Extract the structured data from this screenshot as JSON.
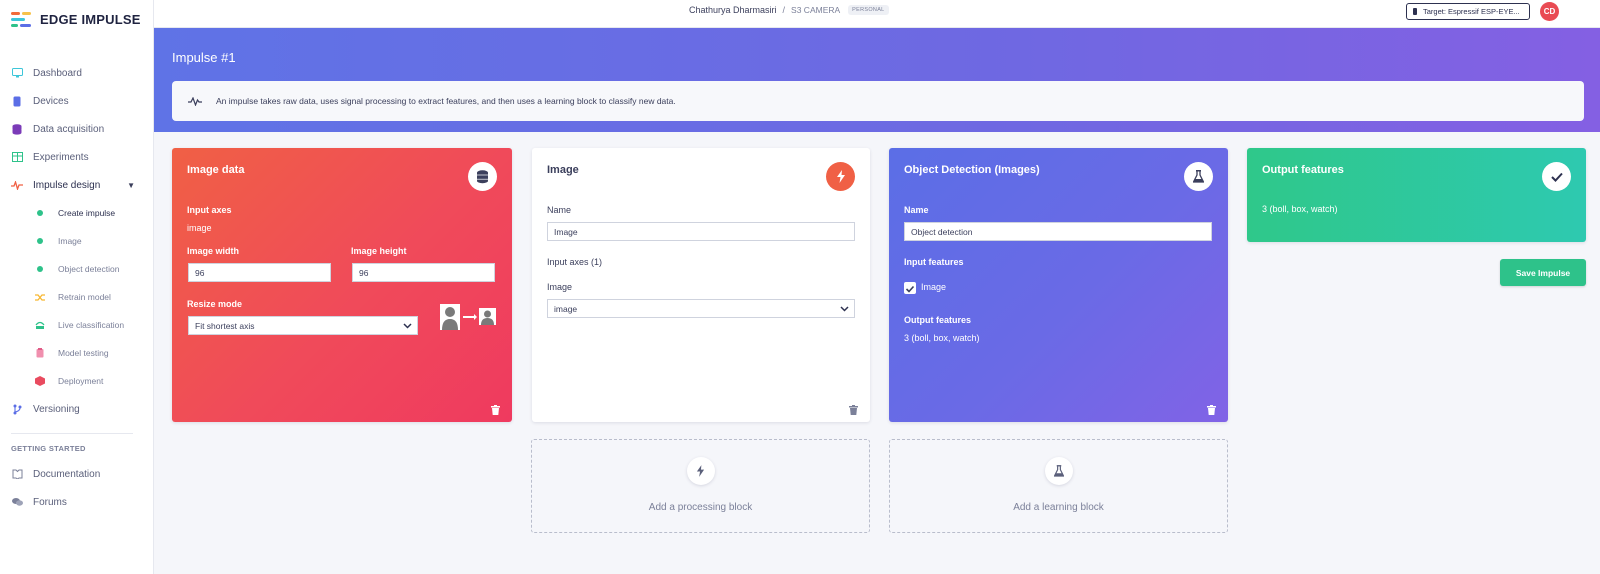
{
  "brand": {
    "name": "EDGE IMPULSE",
    "logo_colors": [
      "#f26b3a",
      "#f7c24a",
      "#3dc6d9",
      "#2ec28a"
    ]
  },
  "sidebar": {
    "items": [
      {
        "label": "Dashboard",
        "icon": "monitor-icon",
        "color": "#3dc6d9"
      },
      {
        "label": "Devices",
        "icon": "device-icon",
        "color": "#5b6ee6"
      },
      {
        "label": "Data acquisition",
        "icon": "database-icon",
        "color": "#7b3bb8"
      },
      {
        "label": "Experiments",
        "icon": "table-icon",
        "color": "#2ec28a"
      },
      {
        "label": "Impulse design",
        "icon": "pulse-icon",
        "color": "#f06045"
      }
    ],
    "sub_items": [
      {
        "label": "Create impulse",
        "icon": "dot-icon"
      },
      {
        "label": "Image",
        "icon": "dot-icon"
      },
      {
        "label": "Object detection",
        "icon": "dot-icon"
      },
      {
        "label": "Retrain model",
        "icon": "shuffle-icon"
      },
      {
        "label": "Live classification",
        "icon": "live-icon"
      },
      {
        "label": "Model testing",
        "icon": "clipboard-icon"
      },
      {
        "label": "Deployment",
        "icon": "box-icon"
      }
    ],
    "versioning": "Versioning",
    "getting_started": "GETTING STARTED",
    "documentation": "Documentation",
    "forums": "Forums"
  },
  "topbar": {
    "user": "Chathurya Dharmasiri",
    "separator": "/",
    "project": "S3 CAMERA",
    "badge": "PERSONAL",
    "target": "Target: Espressif ESP-EYE...",
    "avatar": "CD"
  },
  "header": {
    "title": "Impulse #1",
    "info": "An impulse takes raw data, uses signal processing to extract features, and then uses a learning block to classify new data."
  },
  "image_data_card": {
    "title": "Image data",
    "input_axes_label": "Input axes",
    "input_axes_value": "image",
    "width_label": "Image width",
    "width_value": "96",
    "height_label": "Image height",
    "height_value": "96",
    "resize_label": "Resize mode",
    "resize_value": "Fit shortest axis"
  },
  "processing_card": {
    "title": "Image",
    "name_label": "Name",
    "name_value": "Image",
    "input_axes_label": "Input axes (1)",
    "axis_label": "Image",
    "axis_value": "image"
  },
  "learning_card": {
    "title": "Object Detection (Images)",
    "name_label": "Name",
    "name_value": "Object detection",
    "input_features_label": "Input features",
    "input_feature": "Image",
    "output_features_label": "Output features",
    "output_features_value": "3 (boll, box, watch)"
  },
  "output_card": {
    "title": "Output features",
    "value": "3 (boll, box, watch)"
  },
  "save_button": "Save Impulse",
  "add_processing": "Add a processing block",
  "add_learning": "Add a learning block"
}
